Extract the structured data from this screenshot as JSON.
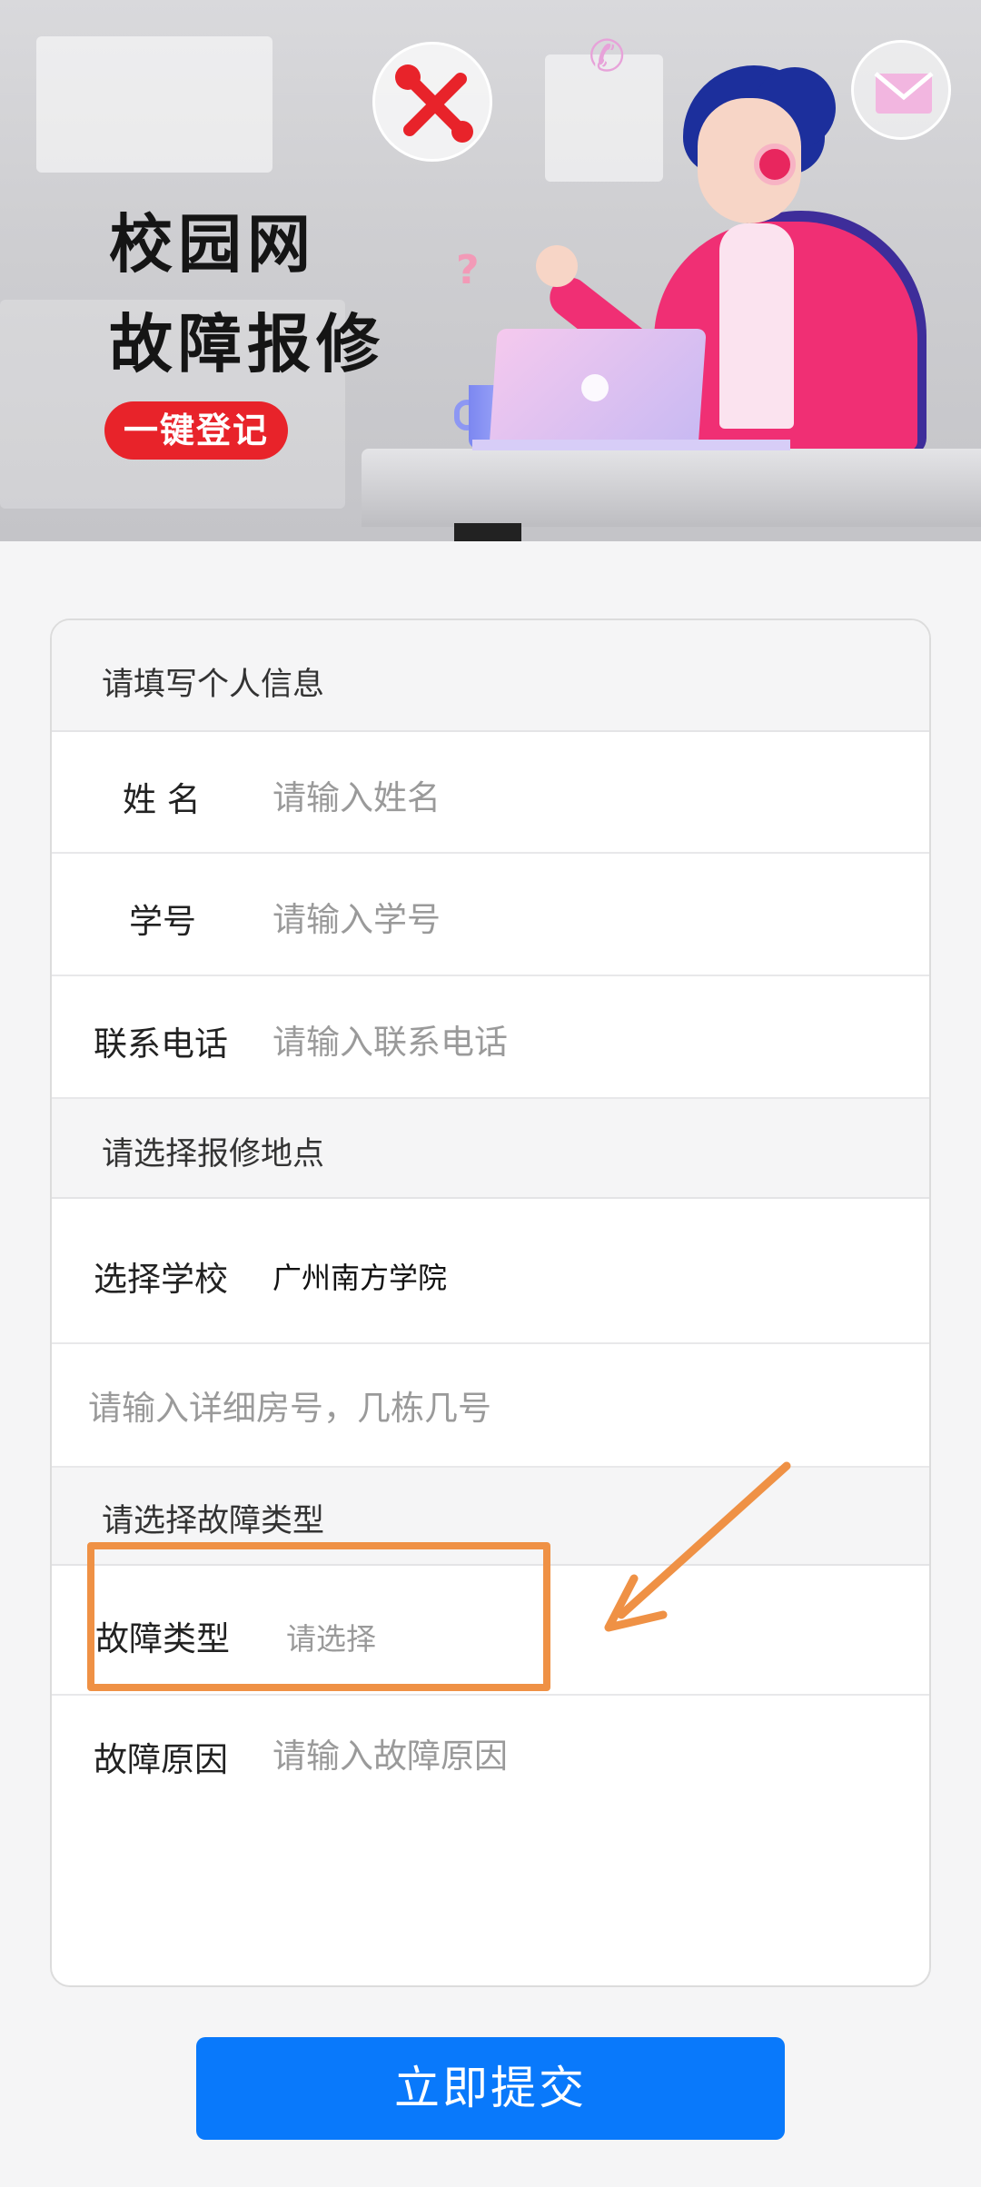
{
  "banner": {
    "title_line1": "校园网",
    "title_line2": "故障报修",
    "badge": "一键登记",
    "question_mark": "?"
  },
  "form": {
    "personal_section": "请填写个人信息",
    "name_label": "姓 名",
    "name_placeholder": "请输入姓名",
    "student_id_label": "学号",
    "student_id_placeholder": "请输入学号",
    "phone_label": "联系电话",
    "phone_placeholder": "请输入联系电话",
    "location_section": "请选择报修地点",
    "school_label": "选择学校",
    "school_value": "广州南方学院",
    "room_placeholder": "请输入详细房号，几栋几号",
    "fault_section": "请选择故障类型",
    "fault_type_label": "故障类型",
    "fault_type_placeholder": "请选择",
    "fault_reason_label": "故障原因",
    "fault_reason_placeholder": "请输入故障原因"
  },
  "submit_label": "立即提交",
  "colors": {
    "primary": "#0979fb",
    "highlight": "#ef9145",
    "badge": "#e8232a"
  }
}
